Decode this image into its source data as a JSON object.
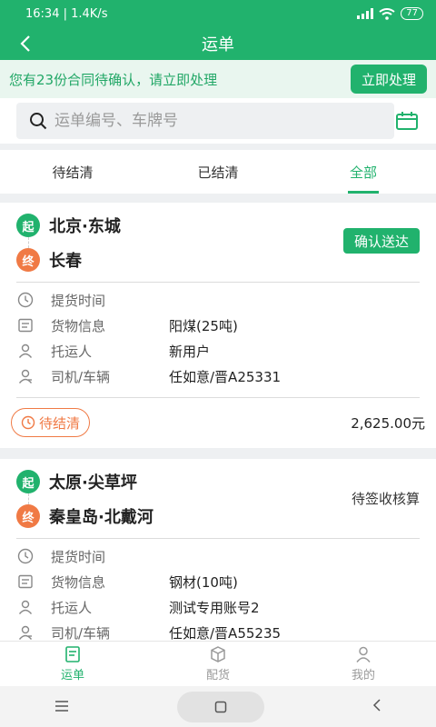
{
  "status_bar": {
    "time_speed": "16:34 | 1.4K/s",
    "battery": "77"
  },
  "header": {
    "title": "运单"
  },
  "notice": {
    "text": "您有23份合同待确认，请立即处理",
    "action": "立即处理"
  },
  "search": {
    "placeholder": "运单编号、车牌号",
    "value": ""
  },
  "tabs": [
    {
      "label": "待结清",
      "active": false
    },
    {
      "label": "已结清",
      "active": false
    },
    {
      "label": "全部",
      "active": true
    }
  ],
  "orders": [
    {
      "start_badge": "起",
      "end_badge": "终",
      "origin": "北京·东城",
      "destination": "长春",
      "action": "确认送达",
      "status": "",
      "pickup_label": "提货时间",
      "pickup_value": "",
      "cargo_label": "货物信息",
      "cargo_value": "阳煤(25吨)",
      "shipper_label": "托运人",
      "shipper_value": "新用户",
      "driver_label": "司机/车辆",
      "driver_value": "任如意/晋A25331",
      "pill": "待结清",
      "amount": "2,625.00元"
    },
    {
      "start_badge": "起",
      "end_badge": "终",
      "origin": "太原·尖草坪",
      "destination": "秦皇岛·北戴河",
      "action": "",
      "status": "待签收核算",
      "pickup_label": "提货时间",
      "pickup_value": "",
      "cargo_label": "货物信息",
      "cargo_value": "钢材(10吨)",
      "shipper_label": "托运人",
      "shipper_value": "测试专用账号2",
      "driver_label": "司机/车辆",
      "driver_value": "任如意/晋A55235"
    }
  ],
  "bottom_nav": [
    {
      "label": "运单",
      "icon": "waybill-icon",
      "active": true
    },
    {
      "label": "配货",
      "icon": "box-icon",
      "active": false
    },
    {
      "label": "我的",
      "icon": "person-icon",
      "active": false
    }
  ],
  "colors": {
    "primary": "#21b26d",
    "accent": "#f07a45",
    "notice_bg": "#e9f6ef"
  }
}
